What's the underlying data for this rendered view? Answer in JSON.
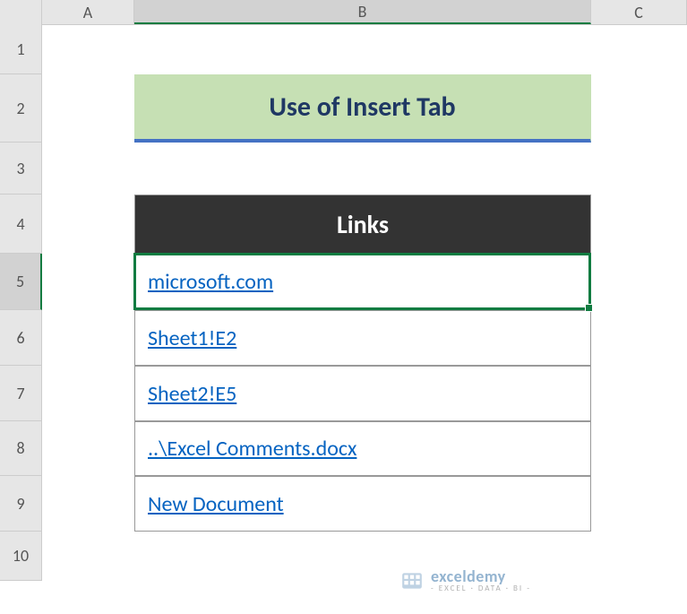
{
  "columns": {
    "A": "A",
    "B": "B",
    "C": "C"
  },
  "rows": {
    "1": "1",
    "2": "2",
    "3": "3",
    "4": "4",
    "5": "5",
    "6": "6",
    "7": "7",
    "8": "8",
    "9": "9",
    "10": "10"
  },
  "title": "Use of Insert Tab",
  "table": {
    "header": "Links",
    "items": [
      "microsoft.com",
      "Sheet1!E2",
      "Sheet2!E5",
      "..\\Excel Comments.docx",
      "New Document"
    ]
  },
  "watermark": {
    "main": "exceldemy",
    "sub": "- EXCEL · DATA · BI -"
  },
  "active": {
    "row": "5",
    "col": "B"
  }
}
